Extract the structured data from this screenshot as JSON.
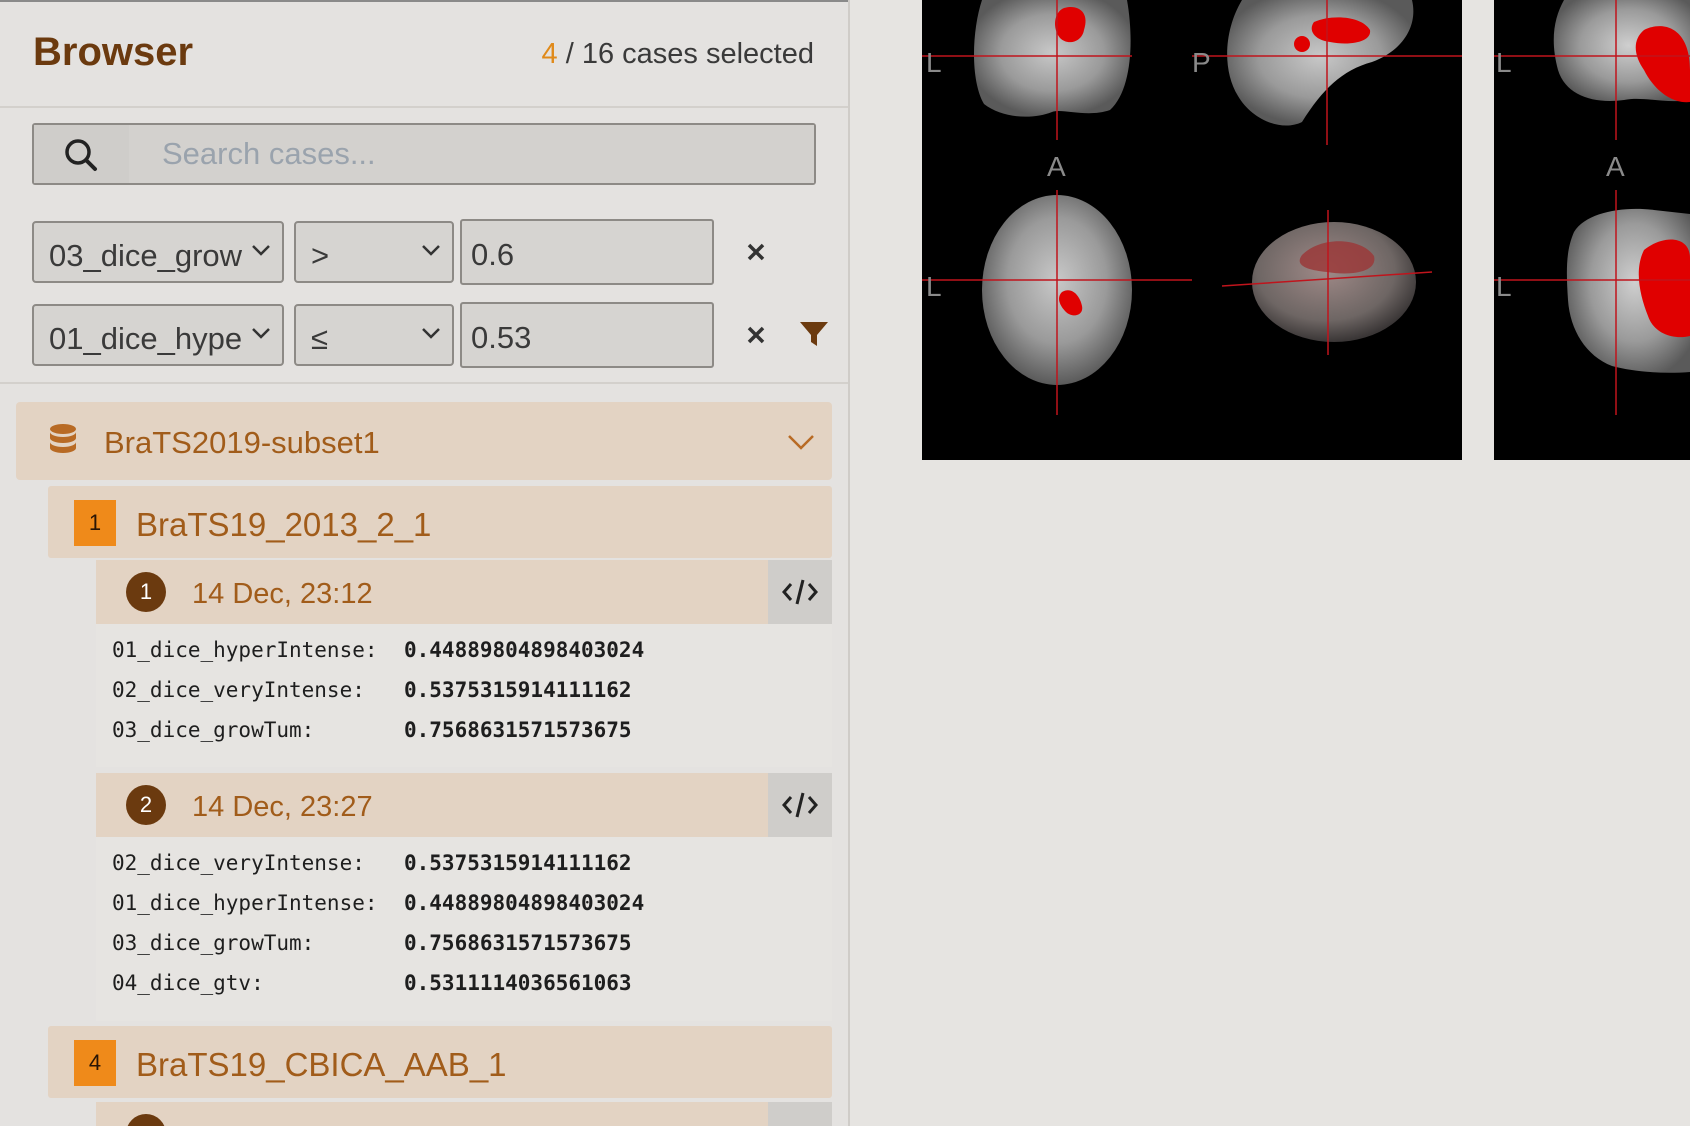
{
  "browser": {
    "title": "Browser",
    "selected_count": "4",
    "selected_suffix": " / 16 cases selected"
  },
  "search": {
    "placeholder": "Search cases..."
  },
  "filters": [
    {
      "field": "03_dice_grow",
      "operator": ">",
      "value": "0.6"
    },
    {
      "field": "01_dice_hype",
      "operator": "≤",
      "value": "0.53"
    }
  ],
  "group": {
    "label": "BraTS2019-subset1"
  },
  "cases": [
    {
      "badge": "1",
      "label": "BraTS19_2013_2_1",
      "runs": [
        {
          "number": "1",
          "date": "14 Dec, 23:12",
          "metrics": [
            {
              "key": "01_dice_hyperIntense:",
              "value": "0.44889804898403024"
            },
            {
              "key": "02_dice_veryIntense:",
              "value": "0.5375315914111162"
            },
            {
              "key": "03_dice_growTum:",
              "value": "0.7568631571573675"
            }
          ]
        },
        {
          "number": "2",
          "date": "14 Dec, 23:27",
          "metrics": [
            {
              "key": "02_dice_veryIntense:",
              "value": "0.5375315914111162"
            },
            {
              "key": "01_dice_hyperIntense:",
              "value": "0.44889804898403024"
            },
            {
              "key": "03_dice_growTum:",
              "value": "0.7568631571573675"
            },
            {
              "key": "04_dice_gtv:",
              "value": "0.5311114036561063"
            }
          ]
        }
      ]
    },
    {
      "badge": "4",
      "label": "BraTS19_CBICA_AAB_1"
    }
  ],
  "viewer_labels": {
    "left": "L",
    "posterior": "P",
    "anterior": "A"
  },
  "colors": {
    "accent": "#ef8a1a",
    "brand_dark": "#6b3a0f",
    "group_bg": "#e3d3c3",
    "lesion": "#e00000"
  }
}
